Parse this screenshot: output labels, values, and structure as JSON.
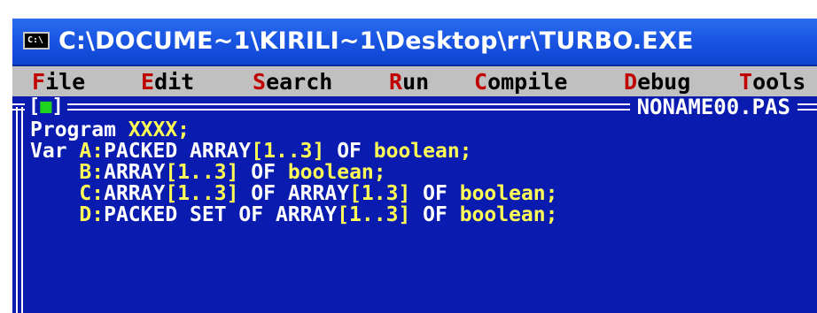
{
  "window": {
    "title": "C:\\DOCUME~1\\KIRILI~1\\Desktop\\rr\\TURBO.EXE",
    "icon_label": "C:\\",
    "icon_name": "console-icon"
  },
  "menu": {
    "items": [
      {
        "hot": "F",
        "rest": "ile"
      },
      {
        "hot": "E",
        "rest": "dit"
      },
      {
        "hot": "S",
        "rest": "earch"
      },
      {
        "hot": "R",
        "rest": "un"
      },
      {
        "hot": "C",
        "rest": "ompile"
      },
      {
        "hot": "D",
        "rest": "ebug"
      },
      {
        "hot": "T",
        "rest": "ools"
      }
    ]
  },
  "editor": {
    "close_open": "[",
    "close_mark": "■",
    "close_close": "]",
    "filename": "NONAME00.PAS",
    "lines": [
      [
        {
          "t": "Program ",
          "c": "w"
        },
        {
          "t": "XXXX;",
          "c": "y"
        }
      ],
      [
        {
          "t": "Var ",
          "c": "w"
        },
        {
          "t": "A:",
          "c": "y"
        },
        {
          "t": "PACKED ARRAY",
          "c": "w"
        },
        {
          "t": "[1..3]",
          "c": "y"
        },
        {
          "t": " OF ",
          "c": "w"
        },
        {
          "t": "boolean;",
          "c": "y"
        }
      ],
      [
        {
          "t": "    B:",
          "c": "y"
        },
        {
          "t": "ARRAY",
          "c": "w"
        },
        {
          "t": "[1..3]",
          "c": "y"
        },
        {
          "t": " OF ",
          "c": "w"
        },
        {
          "t": "boolean;",
          "c": "y"
        }
      ],
      [
        {
          "t": "    C:",
          "c": "y"
        },
        {
          "t": "ARRAY",
          "c": "w"
        },
        {
          "t": "[1..3]",
          "c": "y"
        },
        {
          "t": " OF ",
          "c": "w"
        },
        {
          "t": "ARRAY",
          "c": "w"
        },
        {
          "t": "[1.3]",
          "c": "y"
        },
        {
          "t": " OF ",
          "c": "w"
        },
        {
          "t": "boolean;",
          "c": "y"
        }
      ],
      [
        {
          "t": "    D:",
          "c": "y"
        },
        {
          "t": "PACKED SET OF ARRAY",
          "c": "w"
        },
        {
          "t": "[1..3]",
          "c": "y"
        },
        {
          "t": " OF ",
          "c": "w"
        },
        {
          "t": "boolean;",
          "c": "y"
        }
      ]
    ]
  },
  "colors": {
    "editor_bg": "#0a1bb0",
    "menubar_bg": "#c0c0c0",
    "hotkey": "#c00000",
    "keyword_yellow": "#ffff55",
    "text_white": "#ffffff",
    "close_mark_green": "#1ed21e"
  }
}
